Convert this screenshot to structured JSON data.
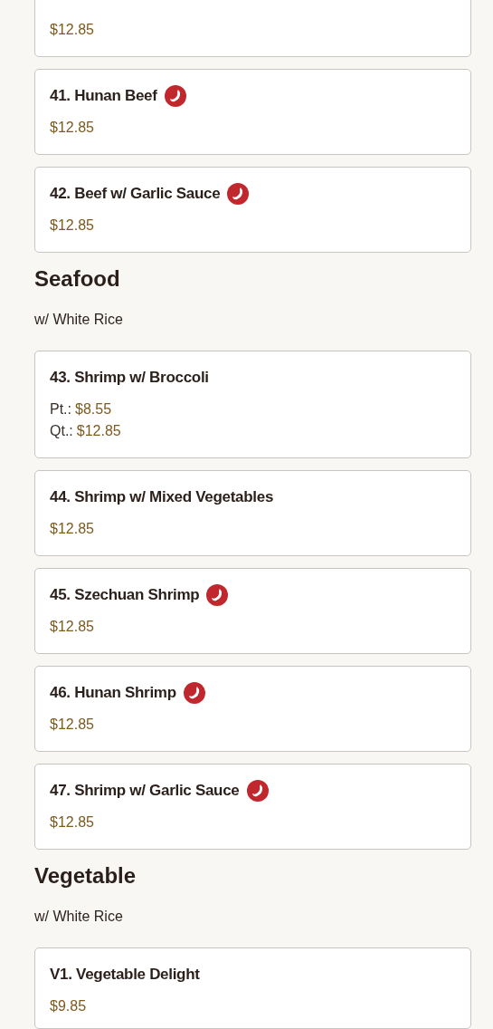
{
  "sections": [
    {
      "items": [
        {
          "prices": [
            {
              "price": "$12.85"
            }
          ]
        },
        {
          "name": "41. Hunan Beef",
          "spicy": true,
          "prices": [
            {
              "price": "$12.85"
            }
          ]
        },
        {
          "name": "42. Beef w/ Garlic Sauce",
          "spicy": true,
          "prices": [
            {
              "price": "$12.85"
            }
          ]
        }
      ]
    },
    {
      "title": "Seafood",
      "note": "w/ White Rice",
      "items": [
        {
          "name": "43. Shrimp w/ Broccoli",
          "spicy": false,
          "prices": [
            {
              "label": "Pt.:",
              "price": "$8.55"
            },
            {
              "label": "Qt.:",
              "price": "$12.85"
            }
          ]
        },
        {
          "name": "44. Shrimp w/ Mixed Vegetables",
          "spicy": false,
          "prices": [
            {
              "price": "$12.85"
            }
          ]
        },
        {
          "name": "45. Szechuan Shrimp",
          "spicy": true,
          "prices": [
            {
              "price": "$12.85"
            }
          ]
        },
        {
          "name": "46. Hunan Shrimp",
          "spicy": true,
          "prices": [
            {
              "price": "$12.85"
            }
          ]
        },
        {
          "name": "47. Shrimp w/ Garlic Sauce",
          "spicy": true,
          "prices": [
            {
              "price": "$12.85"
            }
          ]
        }
      ]
    },
    {
      "title": "Vegetable",
      "note": "w/ White Rice",
      "items": [
        {
          "name": "V1. Vegetable Delight",
          "spicy": false,
          "prices": [
            {
              "price": "$9.85"
            }
          ]
        }
      ]
    }
  ]
}
